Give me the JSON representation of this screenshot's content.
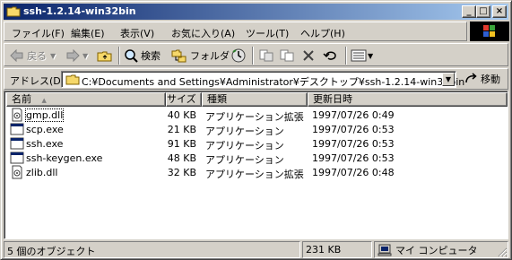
{
  "window": {
    "title": "ssh-1.2.14-win32bin",
    "buttons": {
      "minimize": "_",
      "maximize": "□",
      "close": "×"
    }
  },
  "menu": {
    "items": [
      "ファイル(F)",
      "編集(E)",
      "表示(V)",
      "お気に入り(A)",
      "ツール(T)",
      "ヘルプ(H)"
    ]
  },
  "toolbar": {
    "back": "戻る",
    "search": "検索",
    "folders": "フォルダ",
    "icons": [
      "back-icon",
      "forward-icon",
      "up-folder-icon",
      "search-icon",
      "folders-icon",
      "history-icon",
      "move-to-icon",
      "copy-to-icon",
      "delete-icon",
      "undo-icon",
      "views-icon"
    ]
  },
  "address": {
    "label": "アドレス(D)",
    "value": "C:¥Documents and Settings¥Administrator¥デスクトップ¥ssh-1.2.14-win32bin",
    "go": "移動"
  },
  "list": {
    "columns": {
      "name": "名前",
      "size": "サイズ",
      "type": "種類",
      "modified": "更新日時"
    },
    "sort_indicator": "▲",
    "rows": [
      {
        "name": "gmp.dll",
        "size": "40 KB",
        "type": "アプリケーション拡張",
        "modified": "1997/07/26 0:49",
        "icon": "dll-icon"
      },
      {
        "name": "scp.exe",
        "size": "21 KB",
        "type": "アプリケーション",
        "modified": "1997/07/26 0:53",
        "icon": "exe-icon"
      },
      {
        "name": "ssh.exe",
        "size": "91 KB",
        "type": "アプリケーション",
        "modified": "1997/07/26 0:53",
        "icon": "exe-icon"
      },
      {
        "name": "ssh-keygen.exe",
        "size": "48 KB",
        "type": "アプリケーション",
        "modified": "1997/07/26 0:53",
        "icon": "exe-icon"
      },
      {
        "name": "zlib.dll",
        "size": "32 KB",
        "type": "アプリケーション拡張",
        "modified": "1997/07/26 0:48",
        "icon": "dll-icon"
      }
    ]
  },
  "status": {
    "count": "5 個のオブジェクト",
    "size": "231 KB",
    "location": "マイ コンピュータ"
  },
  "colors": {
    "title_start": "#0a246a",
    "title_end": "#a6caf0",
    "face": "#d4d0c8"
  }
}
